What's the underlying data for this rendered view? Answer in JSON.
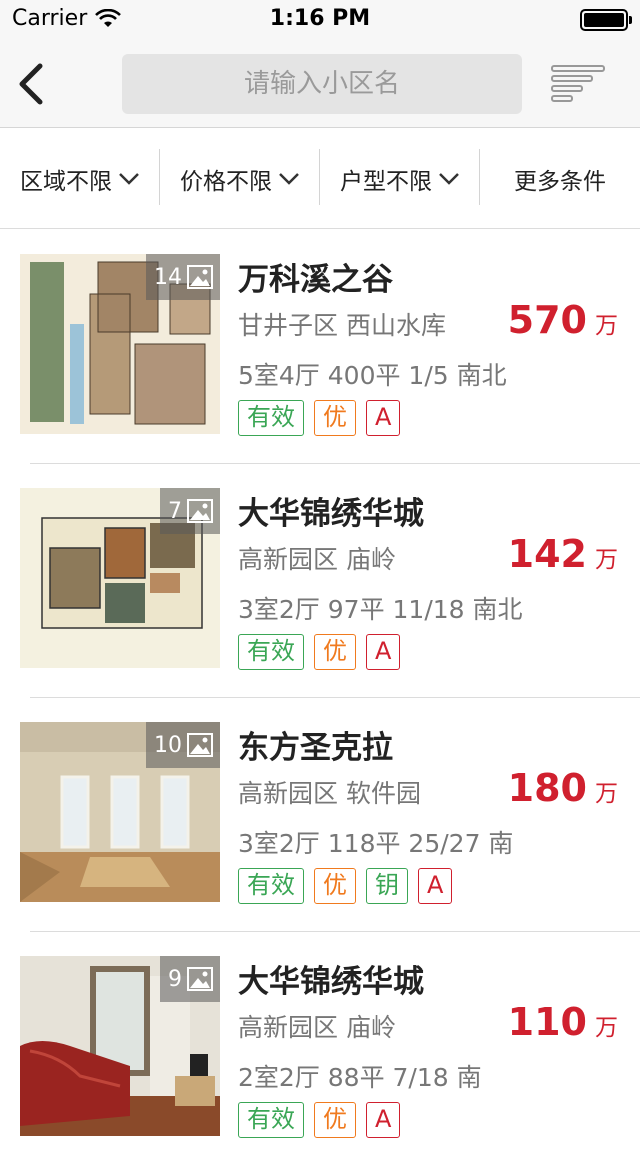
{
  "status_bar": {
    "carrier": "Carrier",
    "time": "1:16 PM"
  },
  "nav": {
    "search_placeholder": "请输入小区名"
  },
  "filters": [
    {
      "label": "区域不限"
    },
    {
      "label": "价格不限"
    },
    {
      "label": "户型不限"
    },
    {
      "label": "更多条件"
    }
  ],
  "listings": [
    {
      "photo_count": "14",
      "title": "万科溪之谷",
      "location": "甘井子区 西山水库",
      "price": "570",
      "unit": "万",
      "specs": "5室4厅 400平 1/5 南北",
      "tags": [
        "有效",
        "优",
        "A"
      ]
    },
    {
      "photo_count": "7",
      "title": "大华锦绣华城",
      "location": "高新园区 庙岭",
      "price": "142",
      "unit": "万",
      "specs": "3室2厅 97平 11/18 南北",
      "tags": [
        "有效",
        "优",
        "A"
      ]
    },
    {
      "photo_count": "10",
      "title": "东方圣克拉",
      "location": "高新园区 软件园",
      "price": "180",
      "unit": "万",
      "specs": "3室2厅 118平 25/27 南",
      "tags": [
        "有效",
        "优",
        "钥",
        "A"
      ]
    },
    {
      "photo_count": "9",
      "title": "大华锦绣华城",
      "location": "高新园区 庙岭",
      "price": "110",
      "unit": "万",
      "specs": "2室2厅 88平 7/18 南",
      "tags": [
        "有效",
        "优",
        "A"
      ]
    }
  ],
  "colors": {
    "price": "#d0202e",
    "tag_green": "#3aa655",
    "tag_orange": "#f07a1e",
    "tag_red": "#d0202e"
  }
}
